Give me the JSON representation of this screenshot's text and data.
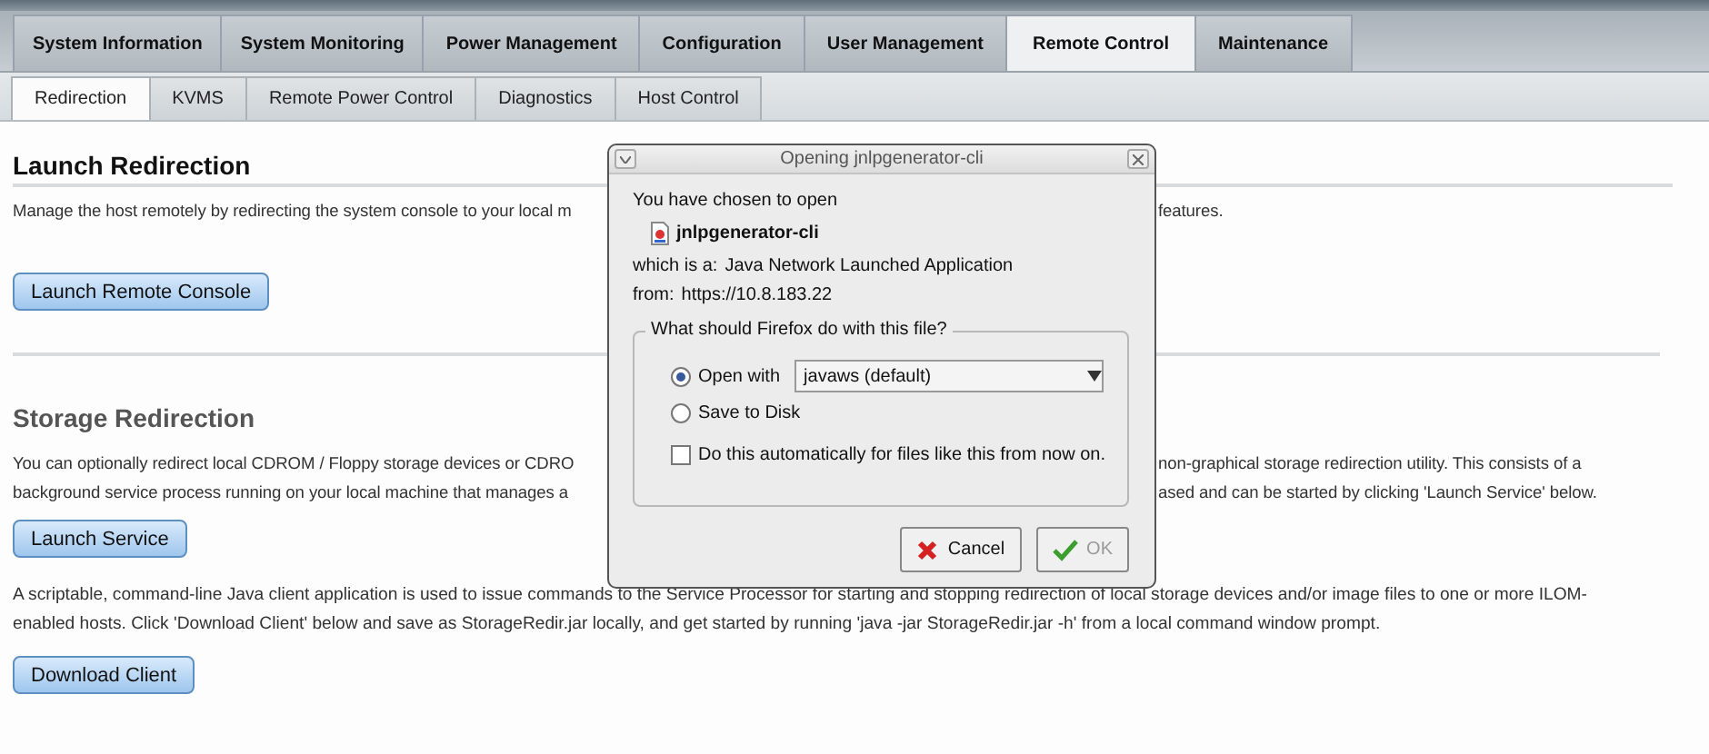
{
  "main_tabs": [
    {
      "label": "System Information",
      "selected": false
    },
    {
      "label": "System Monitoring",
      "selected": false
    },
    {
      "label": "Power Management",
      "selected": false
    },
    {
      "label": "Configuration",
      "selected": false
    },
    {
      "label": "User Management",
      "selected": false
    },
    {
      "label": "Remote Control",
      "selected": true
    },
    {
      "label": "Maintenance",
      "selected": false
    }
  ],
  "sub_tabs": [
    {
      "label": "Redirection",
      "selected": true
    },
    {
      "label": "KVMS",
      "selected": false
    },
    {
      "label": "Remote Power Control",
      "selected": false
    },
    {
      "label": "Diagnostics",
      "selected": false
    },
    {
      "label": "Host Control",
      "selected": false
    }
  ],
  "launch_redirection": {
    "title": "Launch Redirection",
    "description": {
      "left": "Manage the host remotely by redirecting the system console to your local m",
      "right": "features."
    },
    "button": "Launch Remote Console"
  },
  "storage_redirection": {
    "title": "Storage Redirection",
    "description_lines": [
      {
        "left": "You can optionally redirect local CDROM / Floppy storage devices or CDRO",
        "right": "non-graphical storage redirection utility. This consists of a"
      },
      {
        "left": "background service process running on your local machine that manages a",
        "right": "ased and can be started by clicking 'Launch Service' below."
      }
    ],
    "button": "Launch Service",
    "client_text": "A scriptable, command-line Java client application is used to issue commands to the Service Processor for starting and stopping redirection of local storage devices and/or image files to one or more ILOM-enabled hosts. Click 'Download Client' below and save as StorageRedir.jar locally, and get started by running 'java -jar StorageRedir.jar -h' from a local command window prompt.",
    "client_button": "Download Client"
  },
  "dialog": {
    "title": "Opening jnlpgenerator-cli",
    "intro": "You have chosen to open",
    "file_name": "jnlpgenerator-cli",
    "type_label": "which is a:",
    "type_value": "Java Network Launched Application",
    "from_label": "from:",
    "from_value": "https://10.8.183.22",
    "group_title": "What should Firefox do with this file?",
    "options": [
      {
        "label": "Open with",
        "selected": true
      },
      {
        "label": "Save to Disk",
        "selected": false
      }
    ],
    "app_select": "javaws (default)",
    "auto_checkbox": {
      "label": "Do this automatically for files like this from now on.",
      "checked": false
    },
    "buttons": [
      {
        "label": "Cancel",
        "kind": "cancel",
        "disabled": false
      },
      {
        "label": "OK",
        "kind": "ok",
        "disabled": true
      }
    ]
  }
}
